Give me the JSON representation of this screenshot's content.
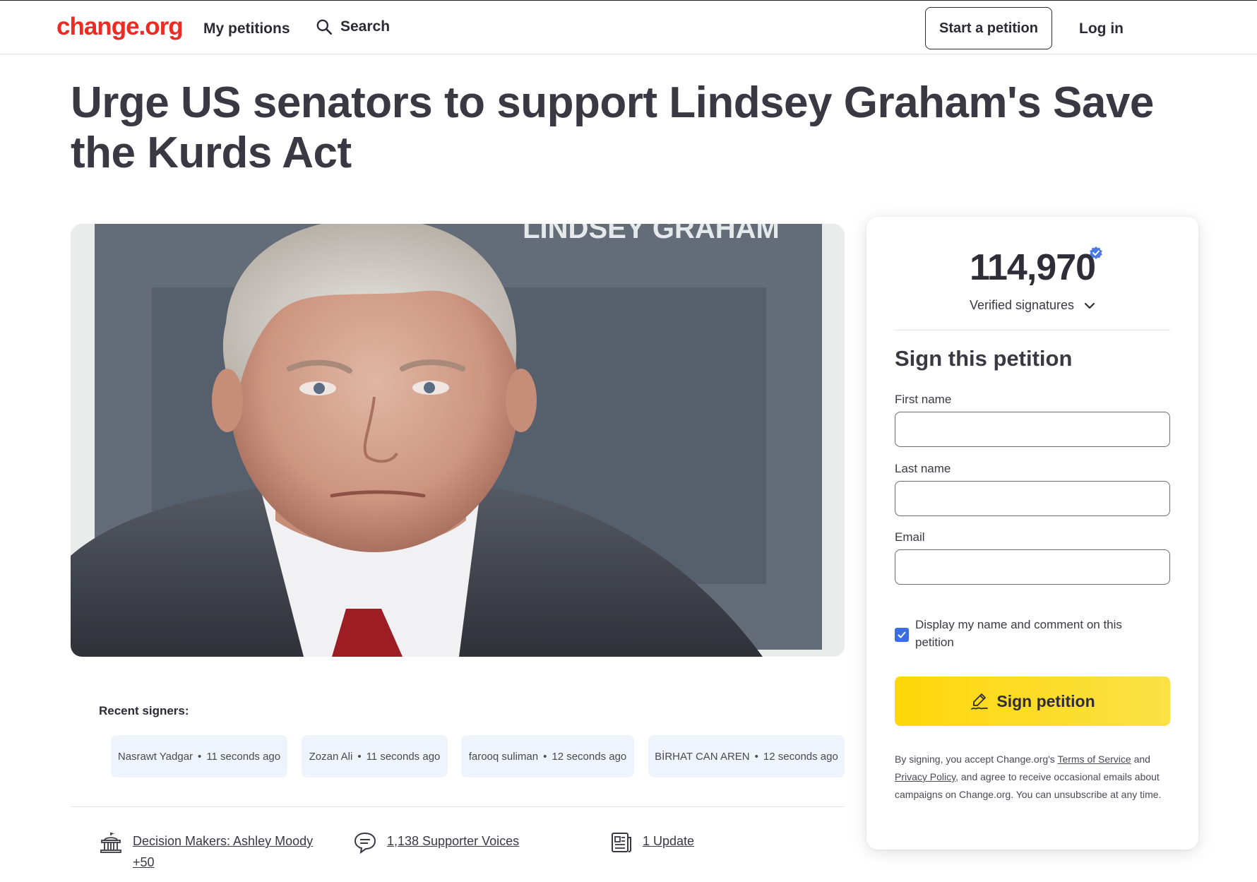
{
  "header": {
    "logo": "change.org",
    "my_petitions": "My petitions",
    "search": "Search",
    "start_petition": "Start a petition",
    "login": "Log in"
  },
  "petition": {
    "title": "Urge US senators to support Lindsey Graham's Save the Kurds Act",
    "image_banner_text": "LINDSEY GRAHAM"
  },
  "recent_signers": {
    "label": "Recent signers:",
    "items": [
      {
        "name": "Nasrawt Yadgar",
        "time": "11 seconds ago"
      },
      {
        "name": "Zozan Ali",
        "time": "11 seconds ago"
      },
      {
        "name": "farooq suliman",
        "time": "12 seconds ago"
      },
      {
        "name": "BİRHAT CAN AREN",
        "time": "12 seconds ago"
      }
    ],
    "separator": "•"
  },
  "stats": {
    "decision_makers_line1": "Decision Makers: Ashley Moody",
    "decision_makers_line2": "+50",
    "supporter_voices": "1,138 Supporter Voices",
    "updates": "1 Update"
  },
  "sign_card": {
    "count": "114,970",
    "verified_label": "Verified signatures",
    "heading": "Sign this petition",
    "first_name_label": "First name",
    "first_name_value": "",
    "last_name_label": "Last name",
    "last_name_value": "",
    "email_label": "Email",
    "email_value": "",
    "display_checkbox_checked": true,
    "display_checkbox_label": "Display my name and comment on this petition",
    "sign_button": "Sign petition",
    "legal_1": "By signing, you accept Change.org's ",
    "terms_link": "Terms of Service",
    "legal_2": " and ",
    "privacy_link": "Privacy Policy",
    "legal_3": ", and agree to receive occasional emails about campaigns on Change.org. You can unsubscribe at any time."
  },
  "colors": {
    "brand_red": "#ec2c22",
    "sign_button_yellow": "#fed709",
    "checkbox_blue": "#3c6ee3",
    "signer_chip_bg": "#eef3fc"
  }
}
